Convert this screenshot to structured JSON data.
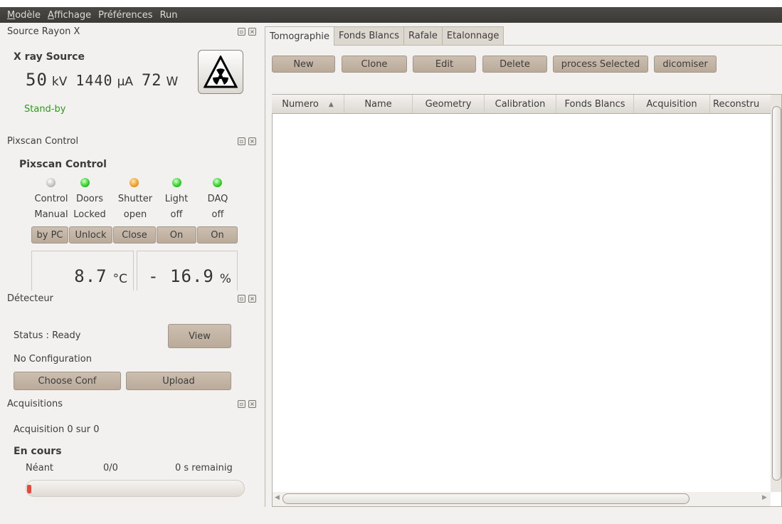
{
  "menu": [
    "Modèle",
    "Affichage",
    "Préférences",
    "Run"
  ],
  "menu_mnemonic": [
    "M",
    "A",
    "",
    ""
  ],
  "menu_rest": [
    "odèle",
    "ffichage",
    "Préférences",
    "Run"
  ],
  "xray": {
    "dock_title": "Source Rayon X",
    "heading": "X ray Source",
    "kv_value": "50",
    "kv_unit": "kV",
    "ua_value": "1440",
    "ua_unit": "µA",
    "w_value": "72",
    "w_unit": "W",
    "status": "Stand-by",
    "status_color": "#2d9a18",
    "radiation_icon": "radiation-icon"
  },
  "pixscan": {
    "dock_title": "Pixscan Control",
    "heading": "Pixscan Control",
    "indicators": [
      {
        "line1": "Control",
        "line2": "Manual",
        "button": "by PC",
        "led": "gray"
      },
      {
        "line1": "Doors",
        "line2": "Locked",
        "button": "Unlock",
        "led": "green"
      },
      {
        "line1": "Shutter",
        "line2": "open",
        "button": "Close",
        "led": "orange"
      },
      {
        "line1": "Light",
        "line2": "off",
        "button": "On",
        "led": "green"
      },
      {
        "line1": "DAQ",
        "line2": "off",
        "button": "On",
        "led": "green"
      }
    ],
    "temperature": "8.7",
    "temperature_unit": "°C",
    "humidity": "- 16.9",
    "humidity_unit": "%"
  },
  "detecteur": {
    "dock_title": "Détecteur",
    "status": "Status : Ready",
    "view_button": "View",
    "config": "No Configuration",
    "choose_button": "Choose Conf",
    "upload_button": "Upload"
  },
  "acquisitions": {
    "dock_title": "Acquisitions",
    "summary": "Acquisition 0 sur 0",
    "en_cours": "En cours",
    "name": "Néant",
    "count": "0/0",
    "remaining": "0 s remainig",
    "progress_fraction": 0.02
  },
  "tabs": [
    "Tomographie",
    "Fonds Blancs",
    "Rafale",
    "Etalonnage"
  ],
  "toolbar": {
    "new": "New",
    "clone": "Clone",
    "edit": "Edit",
    "delete": "Delete",
    "process": "process Selected",
    "dicomiser": "dicomiser"
  },
  "table": {
    "columns": [
      "Numero",
      "Name",
      "Geometry",
      "Calibration",
      "Fonds Blancs",
      "Acquisition",
      "Reconstru"
    ],
    "sort_indicator": "▲",
    "rows": []
  }
}
